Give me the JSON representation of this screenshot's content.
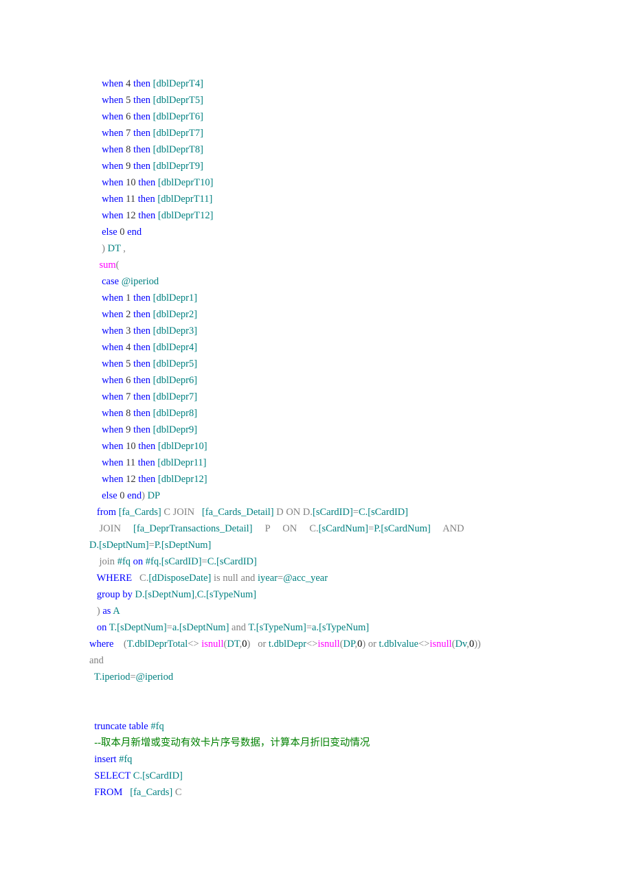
{
  "code_tokens": [
    [
      [
        "     ",
        null
      ],
      [
        "when",
        [
          "k"
        ]
      ],
      [
        " 4 ",
        null
      ],
      [
        "then",
        [
          "k"
        ]
      ],
      [
        " ",
        null
      ],
      [
        "[dblDeprT4]",
        [
          "t"
        ]
      ]
    ],
    [
      [
        "     ",
        null
      ],
      [
        "when",
        [
          "k"
        ]
      ],
      [
        " 5 ",
        null
      ],
      [
        "then",
        [
          "k"
        ]
      ],
      [
        " ",
        null
      ],
      [
        "[dblDeprT5]",
        [
          "t"
        ]
      ]
    ],
    [
      [
        "     ",
        null
      ],
      [
        "when",
        [
          "k"
        ]
      ],
      [
        " 6 ",
        null
      ],
      [
        "then",
        [
          "k"
        ]
      ],
      [
        " ",
        null
      ],
      [
        "[dblDeprT6]",
        [
          "t"
        ]
      ]
    ],
    [
      [
        "     ",
        null
      ],
      [
        "when",
        [
          "k"
        ]
      ],
      [
        " 7 ",
        null
      ],
      [
        "then",
        [
          "k"
        ]
      ],
      [
        " ",
        null
      ],
      [
        "[dblDeprT7]",
        [
          "t"
        ]
      ]
    ],
    [
      [
        "     ",
        null
      ],
      [
        "when",
        [
          "k"
        ]
      ],
      [
        " 8 ",
        null
      ],
      [
        "then",
        [
          "k"
        ]
      ],
      [
        " ",
        null
      ],
      [
        "[dblDeprT8]",
        [
          "t"
        ]
      ]
    ],
    [
      [
        "     ",
        null
      ],
      [
        "when",
        [
          "k"
        ]
      ],
      [
        " 9 ",
        null
      ],
      [
        "then",
        [
          "k"
        ]
      ],
      [
        " ",
        null
      ],
      [
        "[dblDeprT9]",
        [
          "t"
        ]
      ]
    ],
    [
      [
        "     ",
        null
      ],
      [
        "when",
        [
          "k"
        ]
      ],
      [
        " 10 ",
        null
      ],
      [
        "then",
        [
          "k"
        ]
      ],
      [
        " ",
        null
      ],
      [
        "[dblDeprT10]",
        [
          "t"
        ]
      ]
    ],
    [
      [
        "     ",
        null
      ],
      [
        "when",
        [
          "k"
        ]
      ],
      [
        " 11 ",
        null
      ],
      [
        "then",
        [
          "k"
        ]
      ],
      [
        " ",
        null
      ],
      [
        "[dblDeprT11]",
        [
          "t"
        ]
      ]
    ],
    [
      [
        "     ",
        null
      ],
      [
        "when",
        [
          "k"
        ]
      ],
      [
        " 12 ",
        null
      ],
      [
        "then",
        [
          "k"
        ]
      ],
      [
        " ",
        null
      ],
      [
        "[dblDeprT12]",
        [
          "t"
        ]
      ]
    ],
    [
      [
        "     ",
        null
      ],
      [
        "else",
        [
          "k"
        ]
      ],
      [
        " 0 ",
        null
      ],
      [
        "end",
        [
          "k"
        ]
      ]
    ],
    [
      [
        "     ",
        null
      ],
      [
        ")",
        [
          "g"
        ]
      ],
      [
        " DT ",
        [
          "t"
        ]
      ],
      [
        ",",
        [
          "g"
        ]
      ]
    ],
    [
      [
        "    ",
        null
      ],
      [
        "sum",
        [
          "m"
        ]
      ],
      [
        "(",
        [
          "g"
        ]
      ]
    ],
    [
      [
        "     ",
        null
      ],
      [
        "case",
        [
          "k"
        ]
      ],
      [
        " ",
        null
      ],
      [
        "@iperiod",
        [
          "t"
        ]
      ]
    ],
    [
      [
        "     ",
        null
      ],
      [
        "when",
        [
          "k"
        ]
      ],
      [
        " 1 ",
        null
      ],
      [
        "then",
        [
          "k"
        ]
      ],
      [
        " ",
        null
      ],
      [
        "[dblDepr1]",
        [
          "t"
        ]
      ]
    ],
    [
      [
        "     ",
        null
      ],
      [
        "when",
        [
          "k"
        ]
      ],
      [
        " 2 ",
        null
      ],
      [
        "then",
        [
          "k"
        ]
      ],
      [
        " ",
        null
      ],
      [
        "[dblDepr2]",
        [
          "t"
        ]
      ]
    ],
    [
      [
        "     ",
        null
      ],
      [
        "when",
        [
          "k"
        ]
      ],
      [
        " 3 ",
        null
      ],
      [
        "then",
        [
          "k"
        ]
      ],
      [
        " ",
        null
      ],
      [
        "[dblDepr3]",
        [
          "t"
        ]
      ]
    ],
    [
      [
        "     ",
        null
      ],
      [
        "when",
        [
          "k"
        ]
      ],
      [
        " 4 ",
        null
      ],
      [
        "then",
        [
          "k"
        ]
      ],
      [
        " ",
        null
      ],
      [
        "[dblDepr4]",
        [
          "t"
        ]
      ]
    ],
    [
      [
        "     ",
        null
      ],
      [
        "when",
        [
          "k"
        ]
      ],
      [
        " 5 ",
        null
      ],
      [
        "then",
        [
          "k"
        ]
      ],
      [
        " ",
        null
      ],
      [
        "[dblDepr5]",
        [
          "t"
        ]
      ]
    ],
    [
      [
        "     ",
        null
      ],
      [
        "when",
        [
          "k"
        ]
      ],
      [
        " 6 ",
        null
      ],
      [
        "then",
        [
          "k"
        ]
      ],
      [
        " ",
        null
      ],
      [
        "[dblDepr6]",
        [
          "t"
        ]
      ]
    ],
    [
      [
        "     ",
        null
      ],
      [
        "when",
        [
          "k"
        ]
      ],
      [
        " 7 ",
        null
      ],
      [
        "then",
        [
          "k"
        ]
      ],
      [
        " ",
        null
      ],
      [
        "[dblDepr7]",
        [
          "t"
        ]
      ]
    ],
    [
      [
        "     ",
        null
      ],
      [
        "when",
        [
          "k"
        ]
      ],
      [
        " 8 ",
        null
      ],
      [
        "then",
        [
          "k"
        ]
      ],
      [
        " ",
        null
      ],
      [
        "[dblDepr8]",
        [
          "t"
        ]
      ]
    ],
    [
      [
        "     ",
        null
      ],
      [
        "when",
        [
          "k"
        ]
      ],
      [
        " 9 ",
        null
      ],
      [
        "then",
        [
          "k"
        ]
      ],
      [
        " ",
        null
      ],
      [
        "[dblDepr9]",
        [
          "t"
        ]
      ]
    ],
    [
      [
        "     ",
        null
      ],
      [
        "when",
        [
          "k"
        ]
      ],
      [
        " 10 ",
        null
      ],
      [
        "then",
        [
          "k"
        ]
      ],
      [
        " ",
        null
      ],
      [
        "[dblDepr10]",
        [
          "t"
        ]
      ]
    ],
    [
      [
        "     ",
        null
      ],
      [
        "when",
        [
          "k"
        ]
      ],
      [
        " 11 ",
        null
      ],
      [
        "then",
        [
          "k"
        ]
      ],
      [
        " ",
        null
      ],
      [
        "[dblDepr11]",
        [
          "t"
        ]
      ]
    ],
    [
      [
        "     ",
        null
      ],
      [
        "when",
        [
          "k"
        ]
      ],
      [
        " 12 ",
        null
      ],
      [
        "then",
        [
          "k"
        ]
      ],
      [
        " ",
        null
      ],
      [
        "[dblDepr12]",
        [
          "t"
        ]
      ]
    ],
    [
      [
        "     ",
        null
      ],
      [
        "else",
        [
          "k"
        ]
      ],
      [
        " 0 ",
        null
      ],
      [
        "end",
        [
          "k"
        ]
      ],
      [
        ")",
        [
          "g"
        ]
      ],
      [
        " DP",
        [
          "t"
        ]
      ]
    ],
    [
      [
        "   ",
        null
      ],
      [
        "from",
        [
          "k"
        ]
      ],
      [
        " ",
        null
      ],
      [
        "[fa_Cards]",
        [
          "t"
        ]
      ],
      [
        " C JOIN   ",
        [
          "g"
        ]
      ],
      [
        "[fa_Cards_Detail]",
        [
          "t"
        ]
      ],
      [
        " D ON D.",
        [
          "g"
        ]
      ],
      [
        "[sCardID]",
        [
          "t"
        ]
      ],
      [
        "=",
        [
          "g"
        ]
      ],
      [
        "C.",
        [
          "t"
        ]
      ],
      [
        "[sCardID]",
        [
          "t"
        ]
      ]
    ],
    [
      [
        "    ",
        null
      ],
      [
        "JOIN     ",
        [
          "g"
        ]
      ],
      [
        "[fa_DeprTransactions_Detail]",
        [
          "t"
        ]
      ],
      [
        "     P     ON     C.",
        [
          "g"
        ]
      ],
      [
        "[sCardNum]",
        [
          "t"
        ]
      ],
      [
        "=",
        [
          "g"
        ]
      ],
      [
        "P.",
        [
          "t"
        ]
      ],
      [
        "[sCardNum]",
        [
          "t"
        ]
      ],
      [
        "     AND",
        [
          "g"
        ]
      ]
    ],
    [
      [
        "D.",
        [
          "t"
        ]
      ],
      [
        "[sDeptNum]",
        [
          "t"
        ]
      ],
      [
        "=",
        [
          "g"
        ]
      ],
      [
        "P.",
        [
          "t"
        ]
      ],
      [
        "[sDeptNum]",
        [
          "t"
        ]
      ]
    ],
    [
      [
        "    ",
        null
      ],
      [
        "join",
        [
          "g"
        ]
      ],
      [
        " #fq",
        [
          "t"
        ]
      ],
      [
        " on",
        [
          "k"
        ]
      ],
      [
        " #fq.",
        [
          "t"
        ]
      ],
      [
        "[sCardID]",
        [
          "t"
        ]
      ],
      [
        "=",
        [
          "g"
        ]
      ],
      [
        "C.",
        [
          "t"
        ]
      ],
      [
        "[sCardID]",
        [
          "t"
        ]
      ]
    ],
    [
      [
        "   ",
        null
      ],
      [
        "WHERE",
        [
          "k"
        ]
      ],
      [
        "   C.",
        [
          "g"
        ]
      ],
      [
        "[dDisposeDate]",
        [
          "t"
        ]
      ],
      [
        " is null and",
        [
          "g"
        ]
      ],
      [
        " iyear",
        [
          "t"
        ]
      ],
      [
        "=",
        [
          "g"
        ]
      ],
      [
        "@acc_year",
        [
          "t"
        ]
      ]
    ],
    [
      [
        "   ",
        null
      ],
      [
        "group by",
        [
          "k"
        ]
      ],
      [
        " D.",
        [
          "t"
        ]
      ],
      [
        "[sDeptNum]",
        [
          "t"
        ]
      ],
      [
        ",",
        [
          "g"
        ]
      ],
      [
        "C.",
        [
          "t"
        ]
      ],
      [
        "[sTypeNum]",
        [
          "t"
        ]
      ]
    ],
    [
      [
        "   ",
        null
      ],
      [
        ")",
        [
          "g"
        ]
      ],
      [
        " as",
        [
          "k"
        ]
      ],
      [
        " A",
        [
          "t"
        ]
      ]
    ],
    [
      [
        "   ",
        null
      ],
      [
        "on",
        [
          "k"
        ]
      ],
      [
        " T.",
        [
          "t"
        ]
      ],
      [
        "[sDeptNum]",
        [
          "t"
        ]
      ],
      [
        "=",
        [
          "g"
        ]
      ],
      [
        "a.",
        [
          "t"
        ]
      ],
      [
        "[sDeptNum]",
        [
          "t"
        ]
      ],
      [
        " and",
        [
          "g"
        ]
      ],
      [
        " T.",
        [
          "t"
        ]
      ],
      [
        "[sTypeNum]",
        [
          "t"
        ]
      ],
      [
        "=",
        [
          "g"
        ]
      ],
      [
        "a.",
        [
          "t"
        ]
      ],
      [
        "[sTypeNum]",
        [
          "t"
        ]
      ]
    ],
    [
      [
        "where",
        [
          "k"
        ]
      ],
      [
        "    ",
        [
          "g"
        ]
      ],
      [
        "(",
        [
          "g"
        ]
      ],
      [
        "T.dblDeprTotal",
        [
          "t"
        ]
      ],
      [
        "<> ",
        [
          "g"
        ]
      ],
      [
        "isnull",
        [
          "m"
        ]
      ],
      [
        "(",
        [
          "g"
        ]
      ],
      [
        "DT",
        [
          "t"
        ]
      ],
      [
        ",",
        [
          "g"
        ]
      ],
      [
        "0",
        [
          "n"
        ]
      ],
      [
        ")",
        [
          "g"
        ]
      ],
      [
        "   or",
        [
          "g"
        ]
      ],
      [
        " t.dblDepr",
        [
          "t"
        ]
      ],
      [
        "<>",
        [
          "g"
        ]
      ],
      [
        "isnull",
        [
          "m"
        ]
      ],
      [
        "(",
        [
          "g"
        ]
      ],
      [
        "DP",
        [
          "t"
        ]
      ],
      [
        ",",
        [
          "g"
        ]
      ],
      [
        "0",
        [
          "n"
        ]
      ],
      [
        ")",
        [
          "g"
        ]
      ],
      [
        " or",
        [
          "g"
        ]
      ],
      [
        " t.dblvalue",
        [
          "t"
        ]
      ],
      [
        "<>",
        [
          "g"
        ]
      ],
      [
        "isnull",
        [
          "m"
        ]
      ],
      [
        "(",
        [
          "g"
        ]
      ],
      [
        "Dv",
        [
          "t"
        ]
      ],
      [
        ",",
        [
          "g"
        ]
      ],
      [
        "0",
        [
          "n"
        ]
      ],
      [
        "))",
        [
          "g"
        ]
      ]
    ],
    [
      [
        "and",
        [
          "g"
        ]
      ]
    ],
    [
      [
        "  T.iperiod",
        [
          "t"
        ]
      ],
      [
        "=",
        [
          "g"
        ]
      ],
      [
        "@iperiod",
        [
          "t"
        ]
      ]
    ],
    [
      [
        "",
        null
      ]
    ],
    [
      [
        "",
        null
      ]
    ],
    [
      [
        "  ",
        null
      ],
      [
        "truncate table",
        [
          "k"
        ]
      ],
      [
        " #fq",
        [
          "t"
        ]
      ]
    ],
    [
      [
        "  ",
        null
      ],
      [
        "--取本月新增或变动有效卡片序号数据，计算本月折旧变动情况",
        [
          "c"
        ]
      ]
    ],
    [
      [
        "  ",
        null
      ],
      [
        "insert",
        [
          "k"
        ]
      ],
      [
        " #fq",
        [
          "t"
        ]
      ]
    ],
    [
      [
        "  ",
        null
      ],
      [
        "SELECT",
        [
          "k"
        ]
      ],
      [
        " C.",
        [
          "t"
        ]
      ],
      [
        "[sCardID]",
        [
          "t"
        ]
      ]
    ],
    [
      [
        "  ",
        null
      ],
      [
        "FROM",
        [
          "k"
        ]
      ],
      [
        "   ",
        [
          "g"
        ]
      ],
      [
        "[fa_Cards]",
        [
          "t"
        ]
      ],
      [
        " C",
        [
          "g"
        ]
      ]
    ]
  ]
}
